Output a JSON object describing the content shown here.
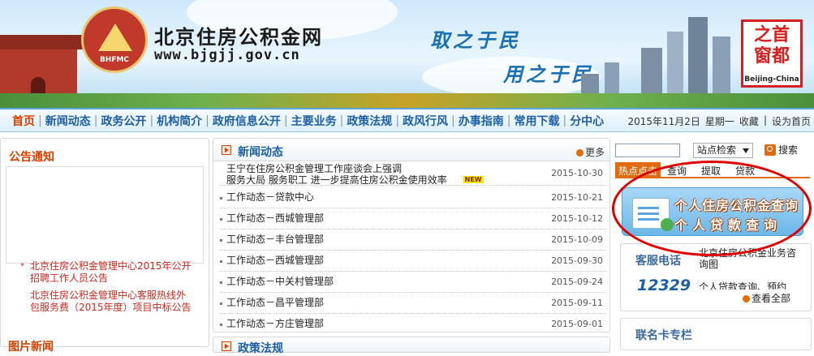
{
  "header": {
    "logo_abbr": "BHFMC",
    "site_name": "北京住房公积金网",
    "site_url": "www.bjgjj.gov.cn",
    "slogan_1": "取之于民",
    "slogan_2": "用之于民",
    "badge_title_1": "之首",
    "badge_title_2": "窗都",
    "badge_sub": "Beijing-China"
  },
  "nav": {
    "items": [
      "首页",
      "新闻动态",
      "政务公开",
      "机构简介",
      "政府信息公开",
      "主要业务",
      "政策法规",
      "政风行风",
      "办事指南",
      "常用下载",
      "分中心"
    ],
    "date": "2015年11月2日",
    "weekday": "星期一",
    "bookmark": "收藏",
    "set_home": "设为首页",
    "sep": "|"
  },
  "left": {
    "title": "公告通知",
    "notices": [
      "北京住房公积金管理中心2015年公开招聘工作人员公告",
      "北京住房公积金管理中心客服热线外包服务费（2015年度）项目中标公告"
    ],
    "bottom_title": "图片新闻"
  },
  "news": {
    "title": "新闻动态",
    "more": "更多",
    "new_tag": "NEW",
    "items": [
      {
        "title_line1": "王宁在住房公积金管理工作座谈会上强调",
        "title_line2": "服务大局 服务职工 进一步提高住房公积金使用效率",
        "date": "2015-10-30"
      },
      {
        "title": "工作动态－贷款中心",
        "date": "2015-10-21"
      },
      {
        "title": "工作动态－西城管理部",
        "date": "2015-10-12"
      },
      {
        "title": "工作动态－丰台管理部",
        "date": "2015-10-09"
      },
      {
        "title": "工作动态－西城管理部",
        "date": "2015-09-30"
      },
      {
        "title": "工作动态－中关村管理部",
        "date": "2015-09-24"
      },
      {
        "title": "工作动态－昌平管理部",
        "date": "2015-09-11"
      },
      {
        "title": "工作动态－方庄管理部",
        "date": "2015-09-01"
      }
    ],
    "policy_title": "政策法规"
  },
  "search": {
    "input_value": "",
    "select_value": "站点检索",
    "button_label": "搜索"
  },
  "tabs": {
    "hot": "热点点击",
    "items": [
      "查询",
      "提取",
      "贷款"
    ]
  },
  "query_banner": {
    "line1": "个人住房公积金查询",
    "line2": "个人贷款查询"
  },
  "service": {
    "title": "客服电话",
    "number": "12329",
    "text1": "北京住房公积金业务咨询图",
    "text2": "个人贷款查询、预约",
    "more": "查看全部"
  },
  "card": {
    "title": "联名卡专栏"
  },
  "colors": {
    "accent_orange": "#e06b10",
    "nav_blue": "#1d5fa6",
    "notice_red": "#c8281e",
    "annotation_red": "#e00000"
  }
}
